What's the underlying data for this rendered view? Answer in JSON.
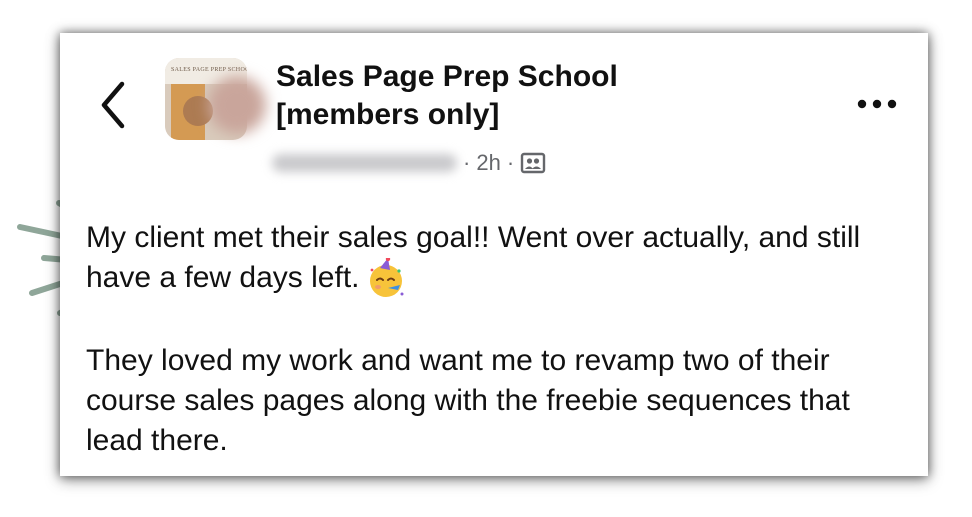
{
  "post": {
    "group_name": "Sales Page Prep School\n[members only]",
    "timestamp": "2h",
    "separator": "·",
    "audience_icon": "group-members-icon",
    "paragraphs": [
      "My client met their sales goal!! Went over actually, and still have a few days left.",
      "They loved my work and want me to revamp two of their course sales pages along with the freebie sequences that lead there."
    ],
    "emoji": "partying-face-emoji"
  },
  "avatar": {
    "caption": "SALES PAGE PREP SCHOOL"
  },
  "icons": {
    "back": "chevron-left-icon",
    "more": "more-horizontal-icon"
  },
  "colors": {
    "text": "#111111",
    "meta": "#65676b",
    "accent_marks": "#8fa699"
  }
}
